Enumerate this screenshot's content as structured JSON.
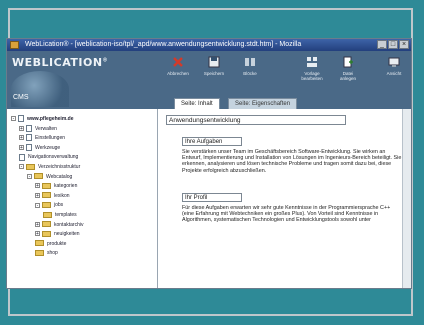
{
  "window": {
    "title": "WebLication® - [weblication-iso/tpl/_apd/www.anwendungsentwicklung.stdt.htm] - Mozilla"
  },
  "banner": {
    "brand": "WEBLICATION",
    "trademark": "®",
    "subtitle": "CMS"
  },
  "toolbar": {
    "items": [
      {
        "label": "Abbrechen",
        "icon": "cancel-icon"
      },
      {
        "label": "Speichern",
        "icon": "save-icon"
      },
      {
        "label": "Blöcke",
        "icon": "blocks-icon"
      },
      {
        "label": "Vorlage\nbearbeiten",
        "icon": "template-icon"
      },
      {
        "label": "Datei\nanlegen",
        "icon": "new-file-icon"
      },
      {
        "label": "Ansicht",
        "icon": "view-icon"
      }
    ]
  },
  "tabs": [
    {
      "label": "Seite: Inhalt",
      "active": true
    },
    {
      "label": "Seite: Eigenschaften",
      "active": false
    }
  ],
  "tree": [
    {
      "label": "www.pflegeheim.de",
      "level": 0,
      "type": "root",
      "expander": "-"
    },
    {
      "label": "Verwalten",
      "level": 1,
      "type": "item",
      "expander": "+"
    },
    {
      "label": "Einstellungen",
      "level": 1,
      "type": "item",
      "expander": "+"
    },
    {
      "label": "Werkzeuge",
      "level": 1,
      "type": "item",
      "expander": "+"
    },
    {
      "label": "Navigationsverwaltung",
      "level": 1,
      "type": "item",
      "expander": ""
    },
    {
      "label": "Verzeichnisstruktur",
      "level": 1,
      "type": "folder",
      "expander": "-"
    },
    {
      "label": "Webcatalog",
      "level": 2,
      "type": "folder",
      "expander": "-"
    },
    {
      "label": "kategorien",
      "level": 3,
      "type": "folder",
      "expander": "+"
    },
    {
      "label": "lexikon",
      "level": 3,
      "type": "folder",
      "expander": "+"
    },
    {
      "label": "jobs",
      "level": 3,
      "type": "folder",
      "expander": "-"
    },
    {
      "label": "templates",
      "level": 4,
      "type": "folder",
      "expander": ""
    },
    {
      "label": "kontaktarchiv",
      "level": 3,
      "type": "folder",
      "expander": "+"
    },
    {
      "label": "neuigkeiten",
      "level": 3,
      "type": "folder",
      "expander": "+"
    },
    {
      "label": "produkte",
      "level": 3,
      "type": "folder",
      "expander": ""
    },
    {
      "label": "shop",
      "level": 3,
      "type": "folder",
      "expander": ""
    }
  ],
  "content": {
    "page_title": "Anwendungsentwicklung",
    "section1_title": "Ihre Aufgaben",
    "section1_text": "Sie verstärken unser Team im Geschäftsbereich Software-Entwicklung. Sie wirken an Entwurf, Implementierung und Installation von Lösungen im Ingenieurs-Bereich beteiligt. Sie erkennen, analysieren und lösen technische Probleme und tragen somit dazu bei, diese Projekte erfolgreich abzuschließen.",
    "section2_title": "Ihr Profil",
    "section2_text": "Für diese Aufgaben erwarten wir sehr gute Kenntnisse in der Programmiersprache C++ (eine Erfahrung mit Webtechniken ein großes Plus). Von Vorteil sind Kenntnisse in Algorithmen, systematischen Technologien und Entwicklungstools sowohl unter"
  }
}
